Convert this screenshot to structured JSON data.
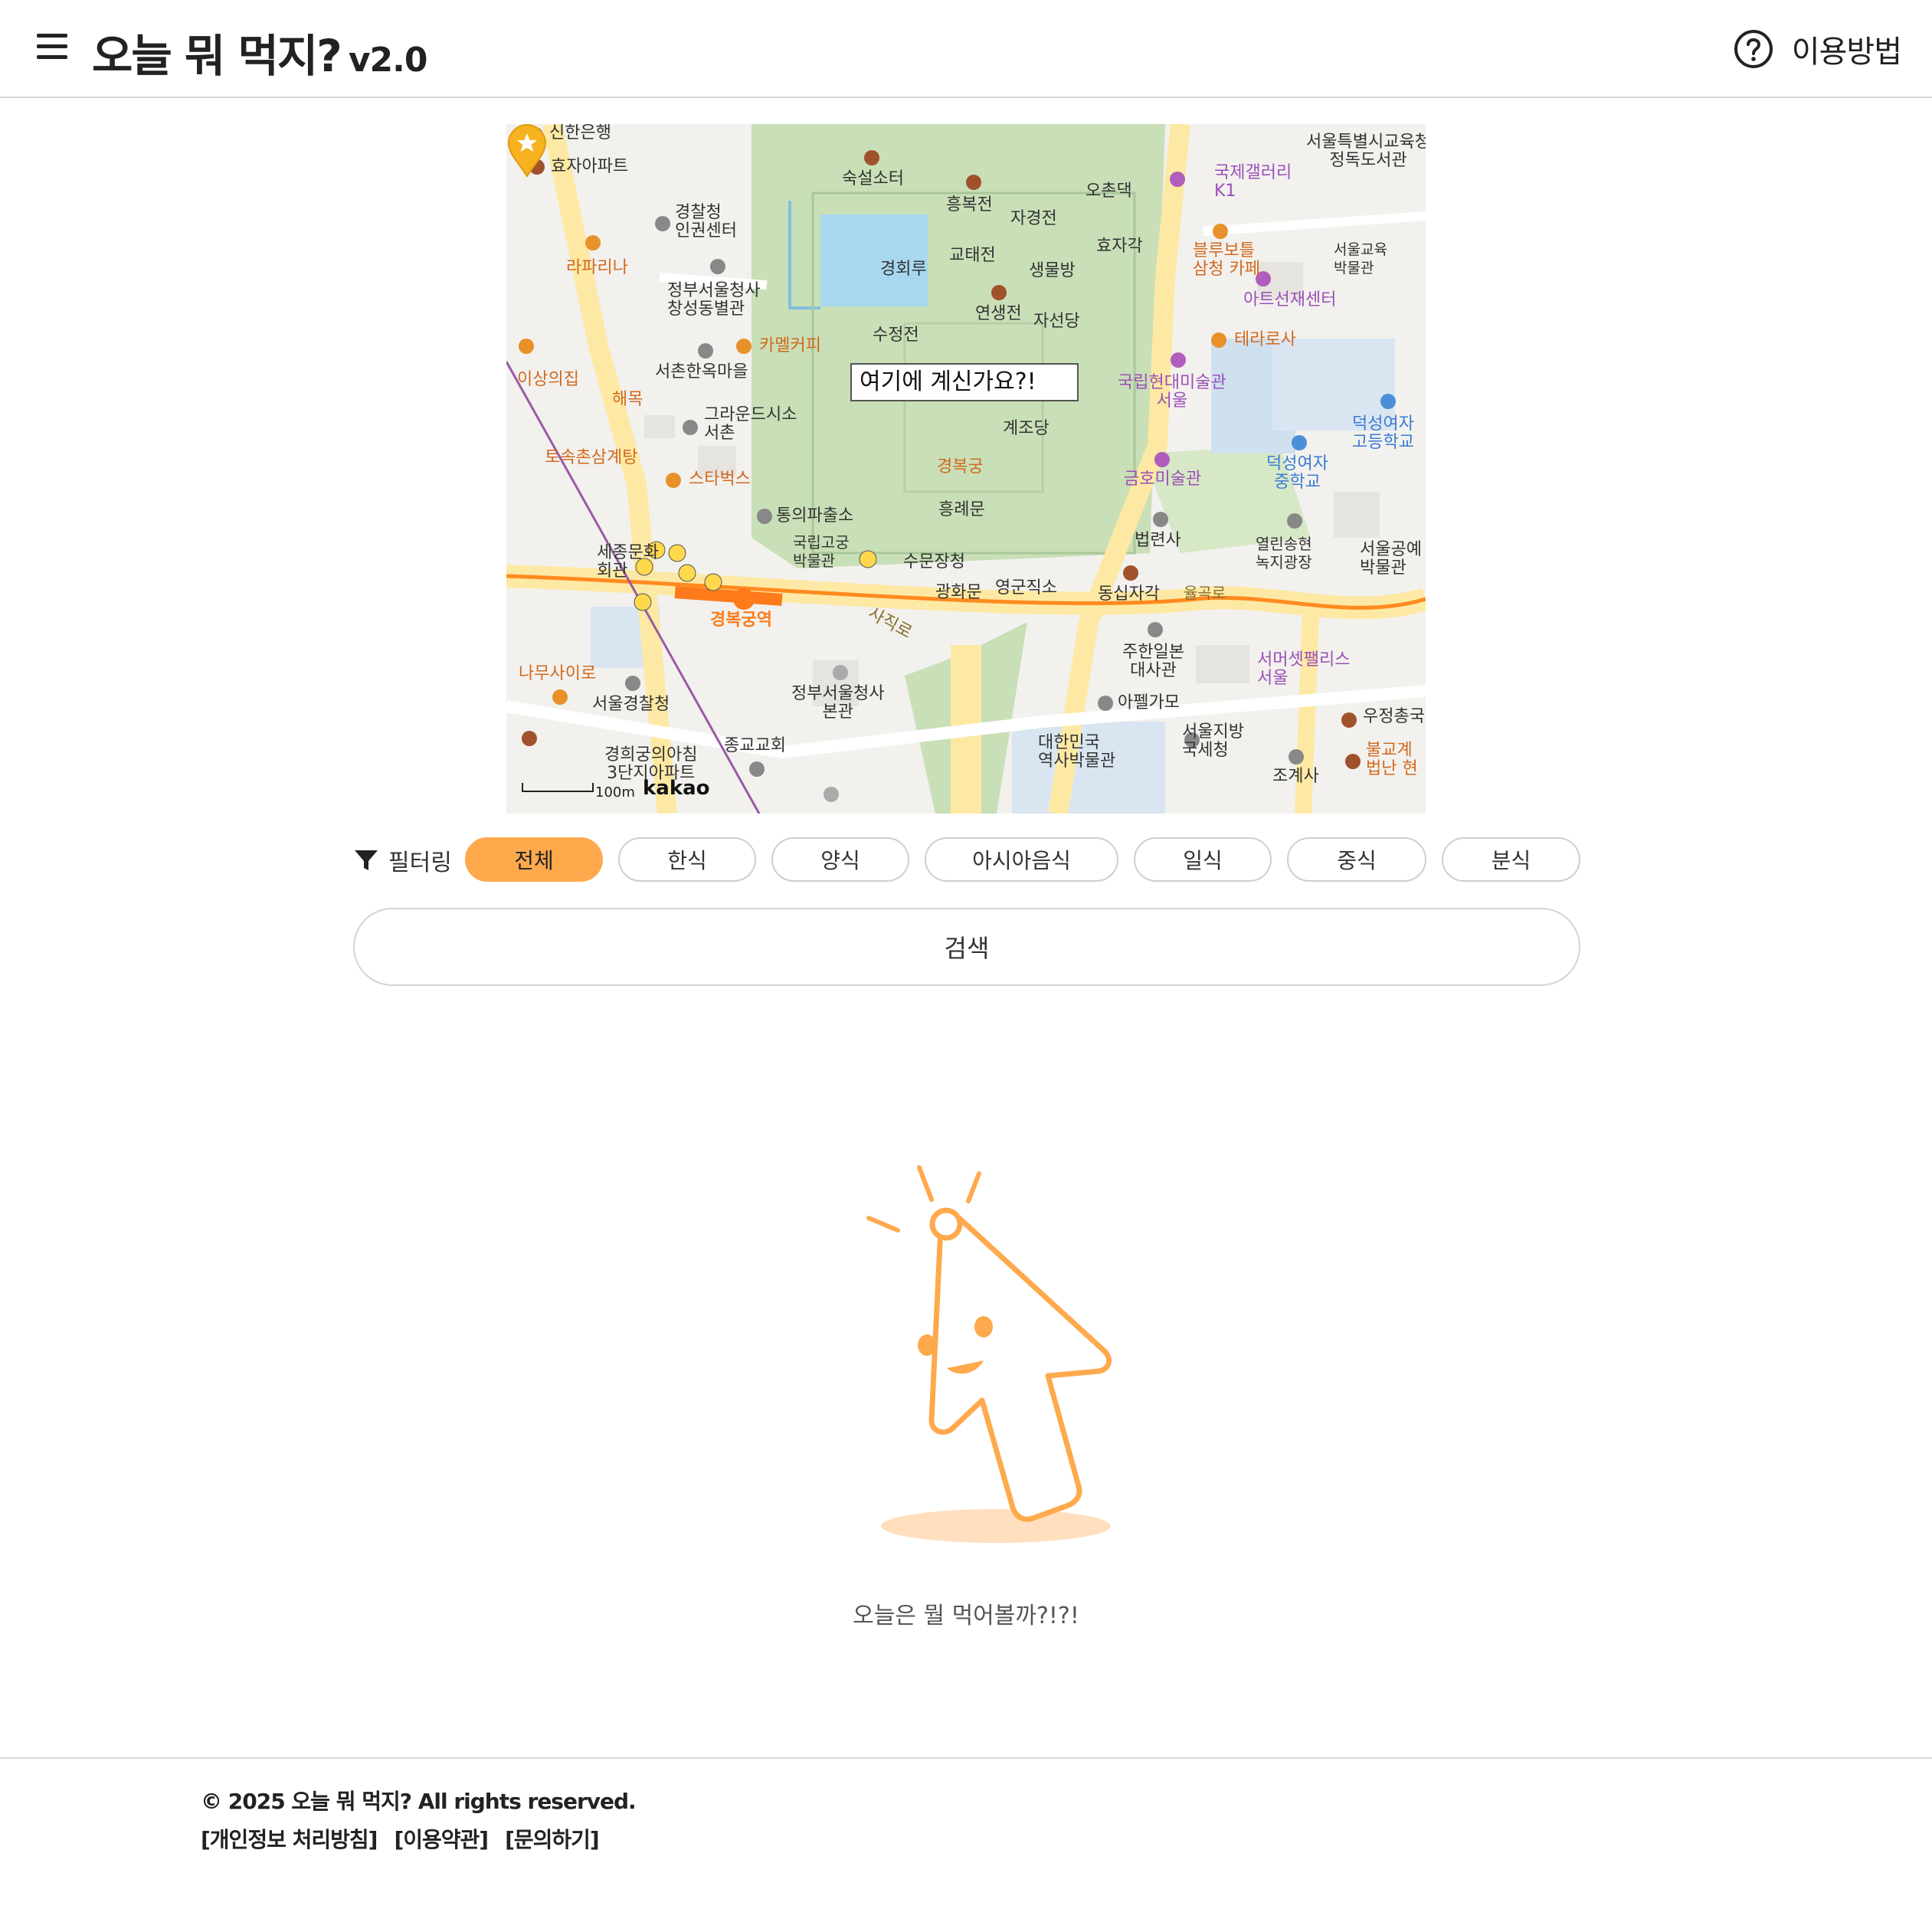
{
  "header": {
    "title": "오늘 뭐 먹지?",
    "version": "v2.0",
    "help_label": "이용방법"
  },
  "map": {
    "tooltip": "여기에 계신가요?!",
    "scale_label": "100m",
    "logo": "kakao",
    "labels": {
      "shinhan": "신한은행",
      "hyoja_apt": "효자아파트",
      "police_hr": "경찰청\n인권센터",
      "lapirina": "라파리나",
      "gov_annex": "정부서울청사\n창성동별관",
      "camel": "카멜커피",
      "seochon_hanok": "서촌한옥마을",
      "isang": "이상의집",
      "haemok": "해목",
      "grounds": "그라운드시소\n서촌",
      "tosokchon": "토속촌삼계탕",
      "starbucks": "스타벅스",
      "sookseol": "숙설소터",
      "heungbok": "흥복전",
      "jagyeong": "자경전",
      "ochundaek": "오촌댁",
      "gyeonghoeru": "경회루",
      "gyotae": "교태전",
      "hyangwon": "효자각",
      "saengmul": "생물방",
      "yeonsaeng": "연생전",
      "jaseon": "자선당",
      "sujeong": "수정전",
      "gyejo": "계조당",
      "gyeongbokgung": "경복궁",
      "heungnye": "흥례문",
      "tongui": "통의파출소",
      "palace_museum": "국립고궁\n박물관",
      "sumun": "수문장청",
      "gwanghwamun": "광화문",
      "yeonggun": "영군직소",
      "dongsipja": "동십자각",
      "mmca": "국립현대미술관\n서울",
      "kumho": "금호미술관",
      "beopryeon": "법련사",
      "intl_gallery": "국제갤러리\nK1",
      "bluebottle": "블루보틀\n삼청 카페",
      "art_sunjae": "아트선재센터",
      "terarosa": "테라로사",
      "seoul_lib": "서울특별시교육청\n정독도서관",
      "edu_museum": "서울교육\n박물관",
      "duksung_high": "덕성여자\n고등학교",
      "duksung_mid": "덕성여자\n중학교",
      "songhyeon": "열린송현\n녹지광장",
      "craft_museum": "서울공예\n박물관",
      "sejong_center": "세종문화\n회관",
      "station": "경복궁역",
      "sajik_ro": "사직로",
      "yulgok_ro": "율곡로",
      "namusa": "나무사이로",
      "seoul_police": "서울경찰청",
      "gov_main": "정부서울청사\n본관",
      "jonggyo": "종교교회",
      "japan_embassy": "주한일본\n대사관",
      "afelgamo": "아펠가모",
      "summerset": "서머셋팰리스\n서울",
      "history_museum": "대한민국\n역사박물관",
      "seoul_tax": "서울지방\n국세청",
      "jogyesa": "조계사",
      "ujeong": "우정총국",
      "gyeonghui_apt": "경희궁의아침\n3단지아파트",
      "bulgyo": "불교계\n법난 현"
    }
  },
  "filter": {
    "label": "필터링",
    "chips": [
      "전체",
      "한식",
      "양식",
      "아시아음식",
      "일식",
      "중식",
      "분식"
    ],
    "active_index": 0
  },
  "search": {
    "label": "검색"
  },
  "empty_state": {
    "message": "오늘은 뭘 먹어볼까?!?!"
  },
  "footer": {
    "copyright": "© 2025 오늘 뭐 먹지? All rights reserved.",
    "links": [
      "[개인정보 처리방침]",
      "[이용약관]",
      "[문의하기]"
    ]
  },
  "colors": {
    "accent": "#ffa94d",
    "border": "#d9d9d9",
    "park": "#c9dfb7",
    "road": "#fde9a3",
    "water": "#a7d8f0"
  },
  "icons": [
    "menu-icon",
    "help-icon",
    "filter-icon",
    "map-pin-icon",
    "pointer-mascot-icon"
  ]
}
